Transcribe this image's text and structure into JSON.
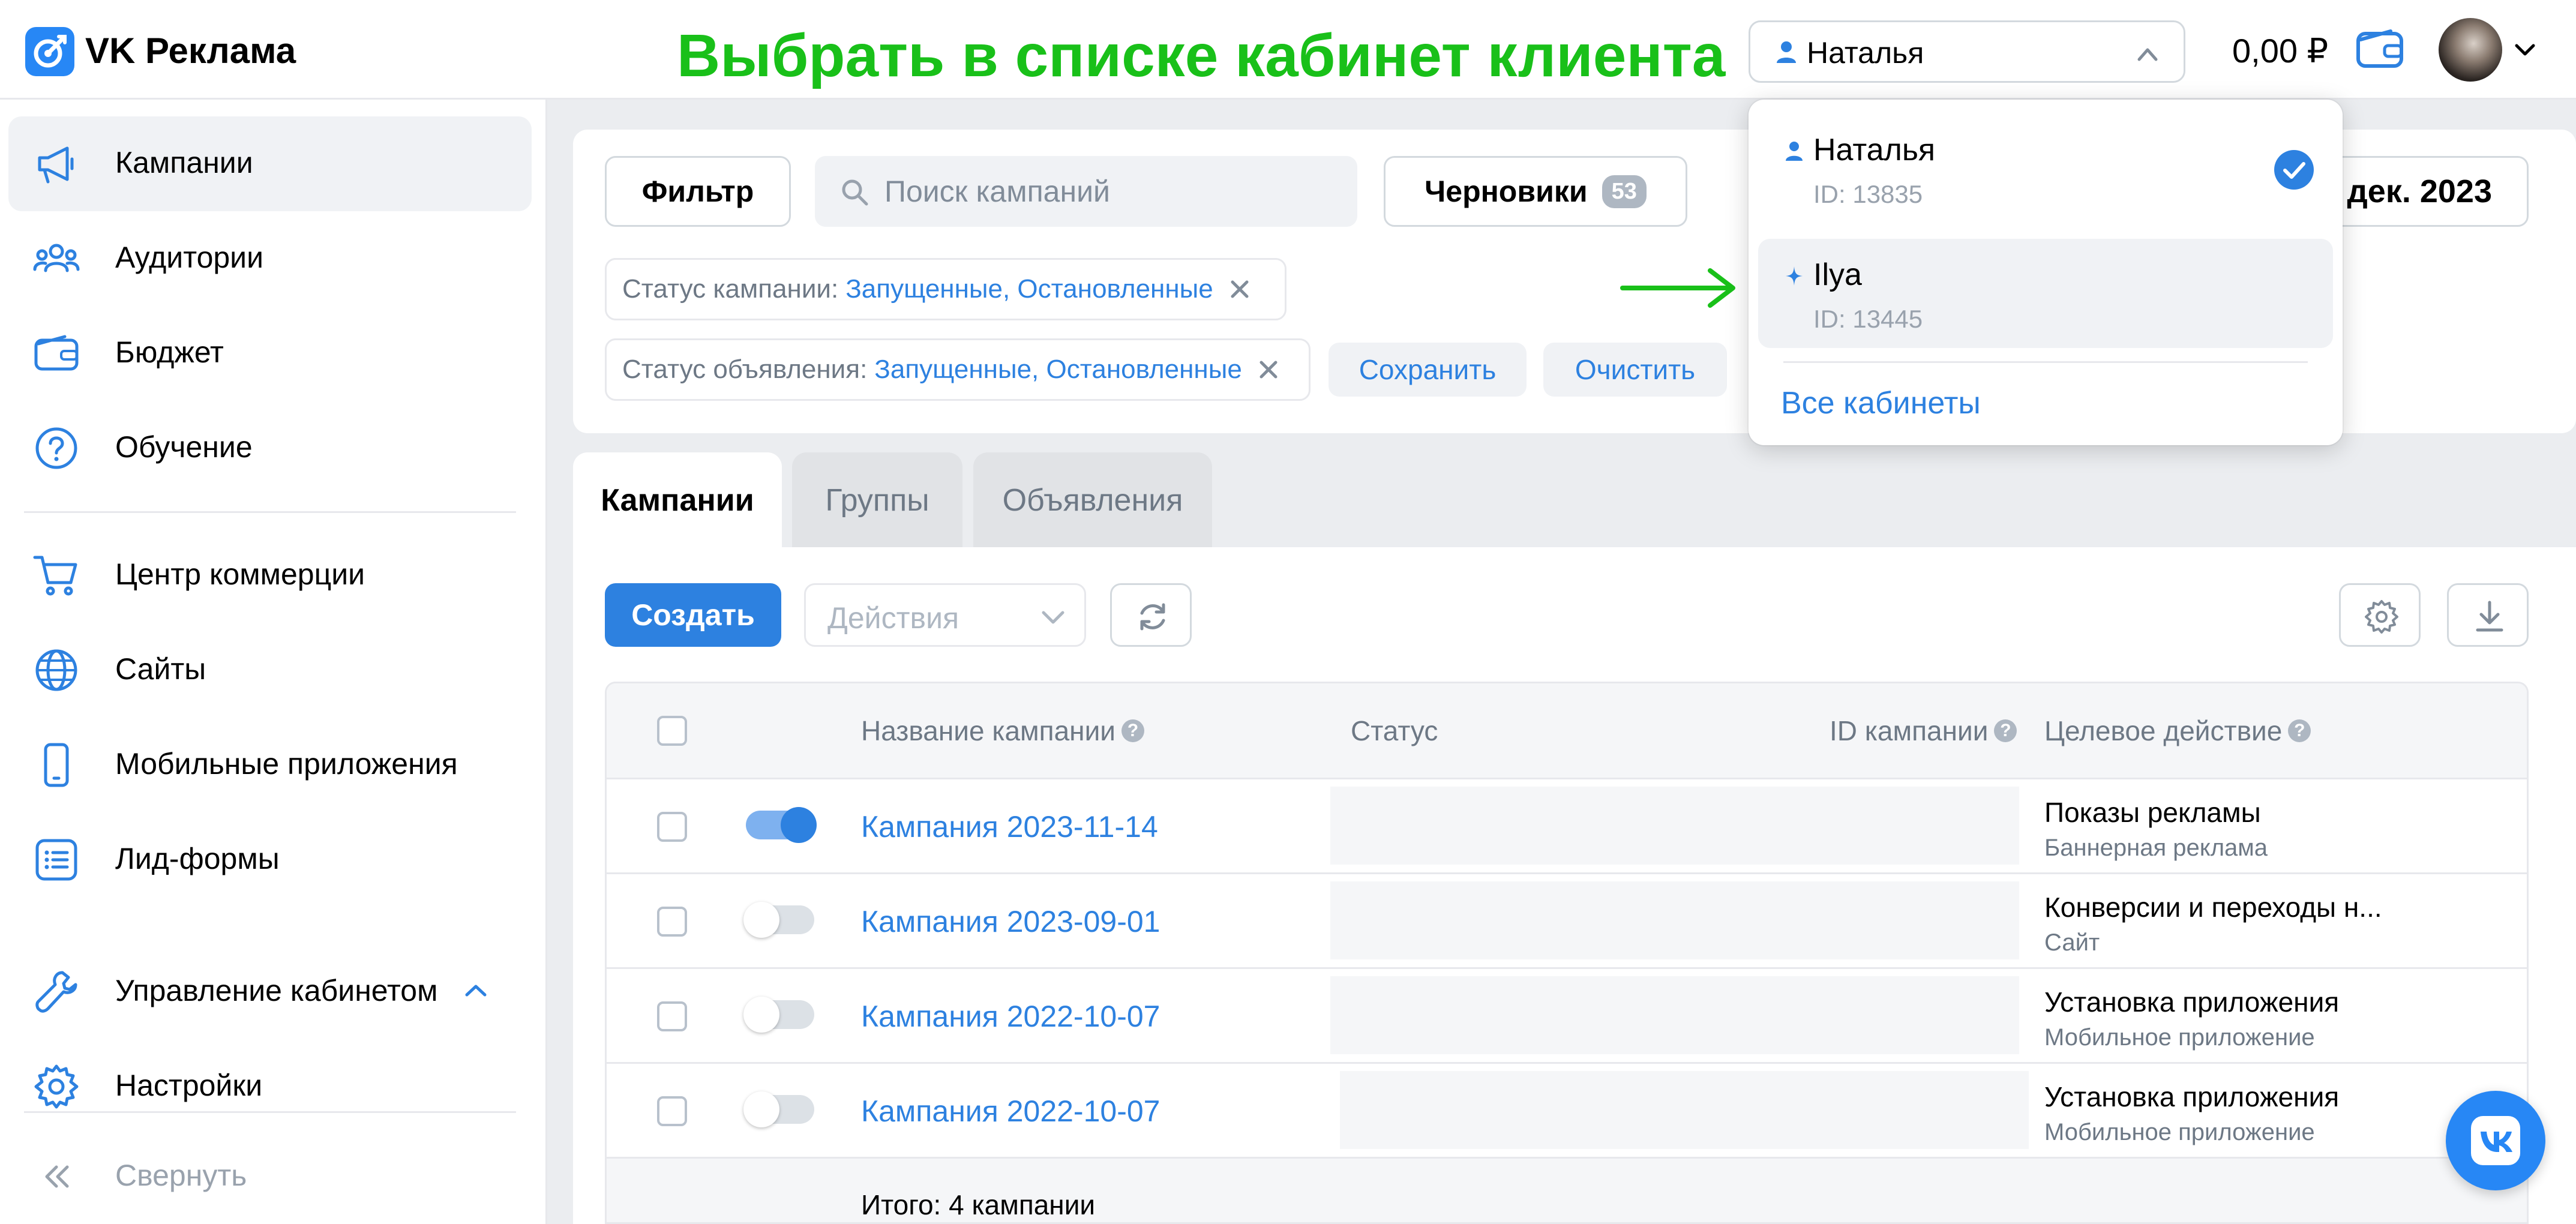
{
  "header": {
    "logo_text": "VK Реклама",
    "annotation": "Выбрать в списке кабинет клиента",
    "account_selector": {
      "selected": "Наталья"
    },
    "balance": "0,00 ₽"
  },
  "sidebar": {
    "items": [
      {
        "label": "Кампании",
        "icon": "megaphone-icon",
        "active": true
      },
      {
        "label": "Аудитории",
        "icon": "users-icon"
      },
      {
        "label": "Бюджет",
        "icon": "wallet-icon"
      },
      {
        "label": "Обучение",
        "icon": "help-circle-icon"
      },
      {
        "label": "Центр коммерции",
        "icon": "cart-icon"
      },
      {
        "label": "Сайты",
        "icon": "globe-icon"
      },
      {
        "label": "Мобильные приложения",
        "icon": "phone-icon"
      },
      {
        "label": "Лид-формы",
        "icon": "list-icon"
      },
      {
        "label": "Управление кабинетом",
        "icon": "wrench-icon"
      },
      {
        "label": "Настройки",
        "icon": "gear-icon"
      }
    ],
    "collapse_label": "Свернуть"
  },
  "filters": {
    "filter_button": "Фильтр",
    "search_placeholder": "Поиск кампаний",
    "drafts_button": "Черновики",
    "drafts_count": "53",
    "date_button": "дек. 2023",
    "chips": [
      {
        "label": "Статус кампании:",
        "value": "Запущенные, Остановленные"
      },
      {
        "label": "Статус объявления:",
        "value": "Запущенные, Остановленные"
      }
    ],
    "save_button": "Сохранить",
    "clear_button": "Очистить"
  },
  "tabs": [
    {
      "label": "Кампании",
      "active": true
    },
    {
      "label": "Группы",
      "active": false
    },
    {
      "label": "Объявления",
      "active": false
    }
  ],
  "toolbar": {
    "create_button": "Создать",
    "actions_select": "Действия"
  },
  "table": {
    "columns": [
      "Название кампании",
      "Статус",
      "ID кампании",
      "Целевое действие"
    ],
    "rows": [
      {
        "name": "Кампания 2023-11-14",
        "enabled": true,
        "target": "Показы рекламы",
        "target_sub": "Баннерная реклама"
      },
      {
        "name": "Кампания 2023-09-01",
        "enabled": false,
        "target": "Конверсии и переходы н...",
        "target_sub": "Сайт"
      },
      {
        "name": "Кампания 2022-10-07",
        "enabled": false,
        "target": "Установка приложения",
        "target_sub": "Мобильное приложение"
      },
      {
        "name": "Кампания 2022-10-07",
        "enabled": false,
        "target": "Установка приложения",
        "target_sub": "Мобильное приложение"
      }
    ],
    "footer": "Итого: 4 кампании"
  },
  "account_dropdown": {
    "items": [
      {
        "name": "Наталья",
        "id_text": "ID: 13835",
        "selected": true,
        "icon": "person-icon"
      },
      {
        "name": "Ilya",
        "id_text": "ID: 13445",
        "selected": false,
        "icon": "sparkle-icon"
      }
    ],
    "all_accounts": "Все кабинеты"
  },
  "colors": {
    "accent": "#2d81e0",
    "annotation_green": "#19c019",
    "brand": "#2787f5"
  }
}
